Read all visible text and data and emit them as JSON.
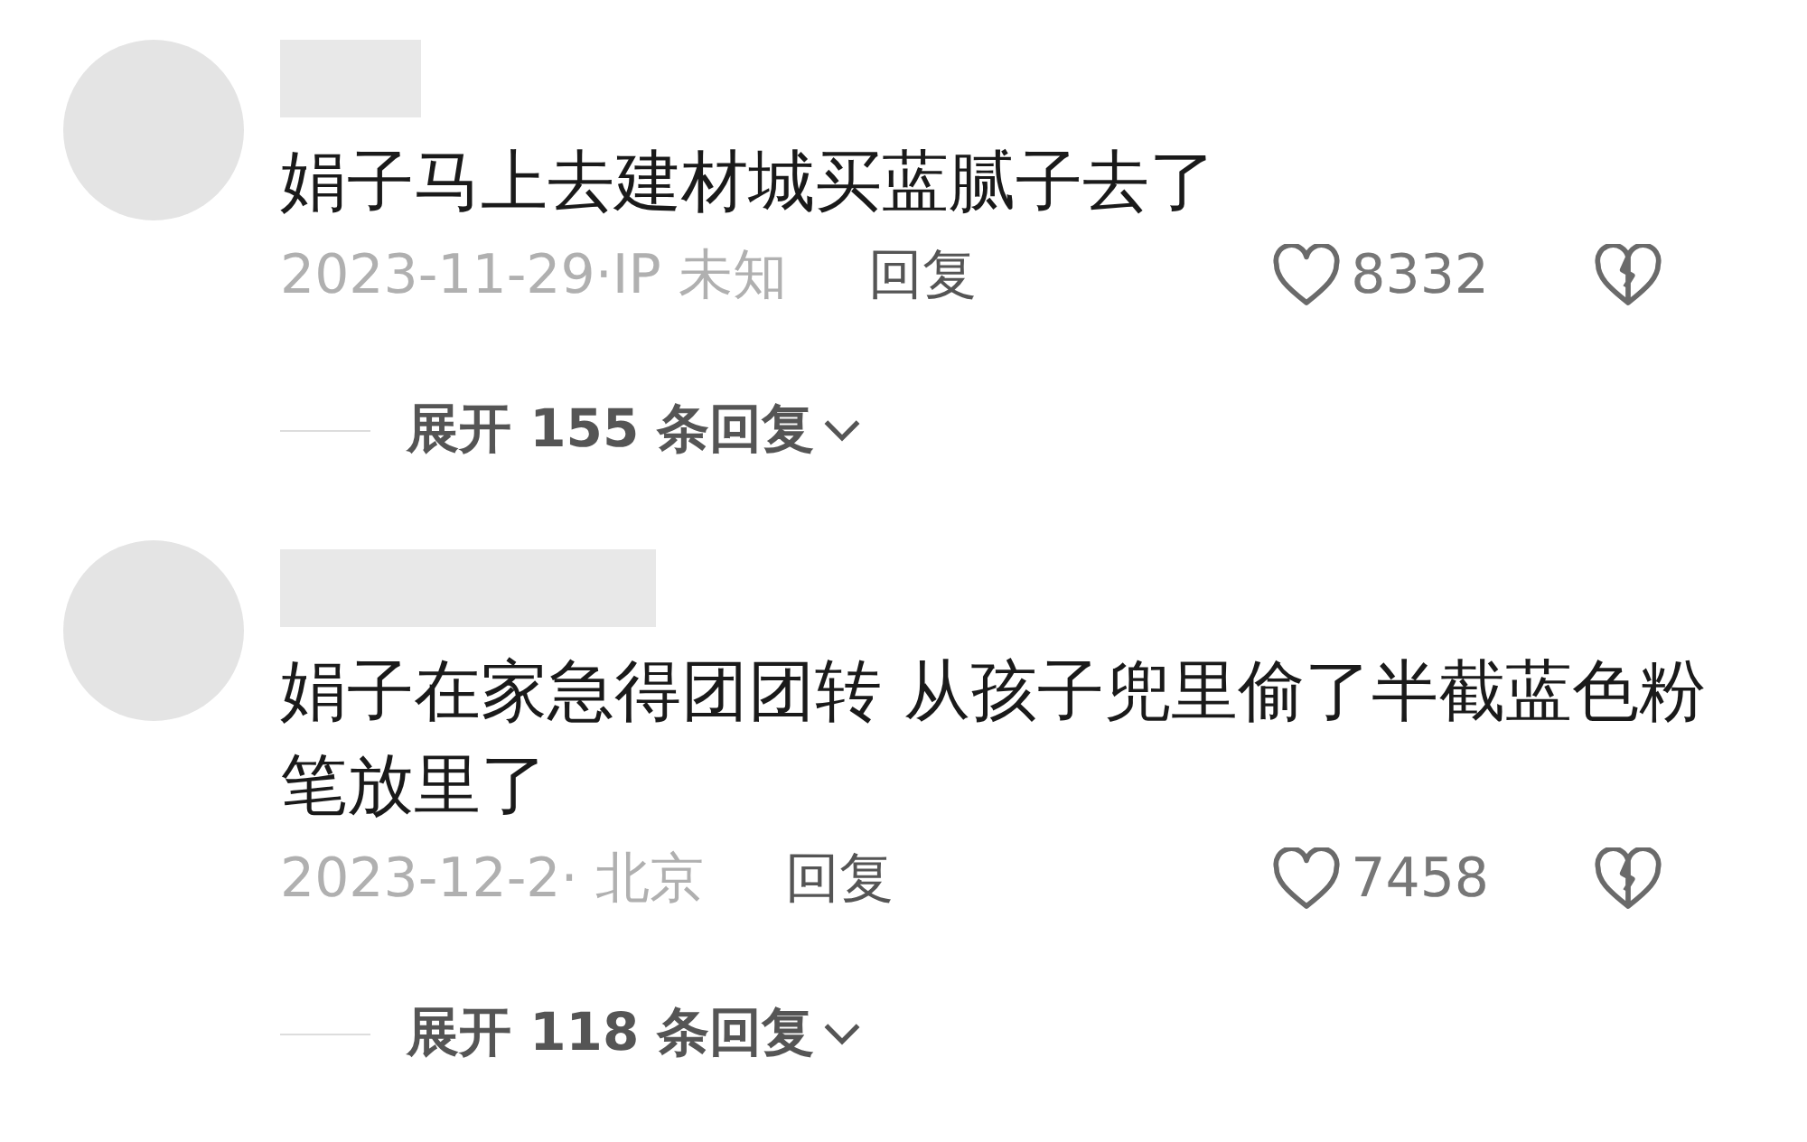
{
  "comments": [
    {
      "text": "娟子马上去建材城买蓝腻子去了",
      "date": "2023-11-29·IP 未知",
      "reply": "回复",
      "likes": "8332",
      "expand": "展开 155 条回复"
    },
    {
      "text": "娟子在家急得团团转 从孩子兜里偷了半截蓝色粉笔放里了",
      "date": "2023-12-2· 北京",
      "reply": "回复",
      "likes": "7458",
      "expand": "展开 118 条回复"
    }
  ]
}
